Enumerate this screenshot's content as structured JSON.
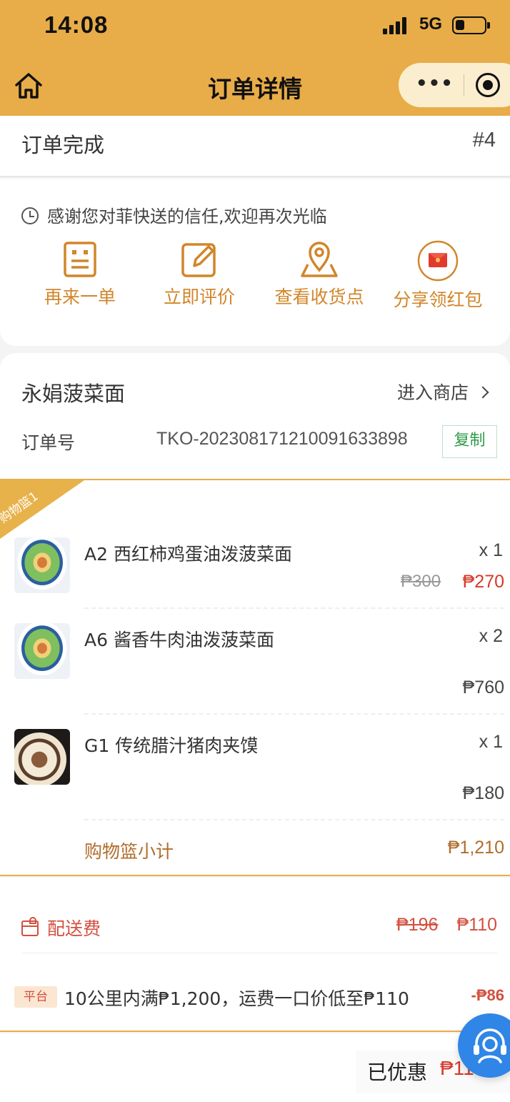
{
  "status_bar": {
    "time": "14:08",
    "network": "5G"
  },
  "nav": {
    "title": "订单详情",
    "more": "•••"
  },
  "order_status": {
    "text": "订单完成",
    "number": "#4"
  },
  "thanks": {
    "message": "感谢您对菲快送的信任,欢迎再次光临",
    "actions": [
      {
        "label": "再来一单",
        "icon": "receipt-icon"
      },
      {
        "label": "立即评价",
        "icon": "edit-icon"
      },
      {
        "label": "查看收货点",
        "icon": "map-pin-icon"
      },
      {
        "label": "分享领红包",
        "icon": "red-envelope-icon"
      }
    ]
  },
  "shop": {
    "name": "永娟菠菜面",
    "enter_label": "进入商店",
    "order_label": "订单号",
    "order_no": "TKO-20230817121009163389​8",
    "copy_label": "复制"
  },
  "basket": {
    "tag": "购物篮1",
    "items": [
      {
        "name": "A2 西红柿鸡蛋油泼菠菜面",
        "qty": "x 1",
        "old_price": "₱300",
        "price": "₱270"
      },
      {
        "name": "A6 酱香牛肉油泼菠菜面",
        "qty": "x 2",
        "price": "₱760"
      },
      {
        "name": "G1 传统腊汁猪肉夹馍",
        "qty": "x 1",
        "price": "₱180"
      }
    ],
    "subtotal_label": "购物篮小计",
    "subtotal": "₱1,210"
  },
  "fees": {
    "delivery_label": "配送费",
    "delivery_old": "₱196",
    "delivery_new": "₱110",
    "promo_tag": "平台",
    "promo_text": "10公里内满₱1,200，运费一口价低至₱110",
    "promo_value": "-₱86"
  },
  "summary": {
    "saved_label": "已优惠",
    "saved_value": "₱110"
  },
  "colors": {
    "accent": "#e8ad48",
    "price_red": "#d43a2a",
    "action_orange": "#d1862a",
    "copy_green": "#2f9a48",
    "support_blue": "#2f86e6"
  }
}
